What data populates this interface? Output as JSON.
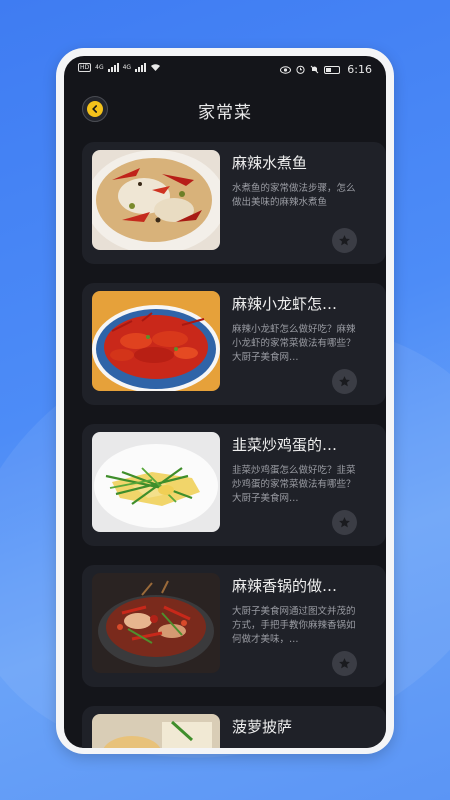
{
  "status_bar": {
    "left_badges": [
      "HD",
      "HD"
    ],
    "network_a": "4G",
    "network_b": "4G",
    "time": "6:16"
  },
  "header": {
    "title": "家常菜"
  },
  "recipes": [
    {
      "title": "麻辣水煮鱼",
      "desc": "水煮鱼的家常做法步骤，怎么做出美味的麻辣水煮鱼",
      "image": "spicy-boiled-fish"
    },
    {
      "title": "麻辣小龙虾怎…",
      "desc": "麻辣小龙虾怎么做好吃？麻辣小龙虾的家常菜做法有哪些？大厨子美食网…",
      "image": "spicy-crayfish"
    },
    {
      "title": "韭菜炒鸡蛋的…",
      "desc": "韭菜炒鸡蛋怎么做好吃？韭菜炒鸡蛋的家常菜做法有哪些？大厨子美食网…",
      "image": "leek-scrambled-eggs"
    },
    {
      "title": "麻辣香锅的做…",
      "desc": "大厨子美食网通过图文并茂的方式，手把手教你麻辣香锅如何做才美味，…",
      "image": "spicy-hot-pot"
    },
    {
      "title": "菠萝披萨",
      "desc": "",
      "image": "pineapple-pizza"
    }
  ],
  "icons": {
    "back": "back-arrow-icon",
    "favorite": "star-icon"
  },
  "colors": {
    "accent": "#f4c21b",
    "screen_bg": "#14151a",
    "card_bg": "#1f2128"
  }
}
